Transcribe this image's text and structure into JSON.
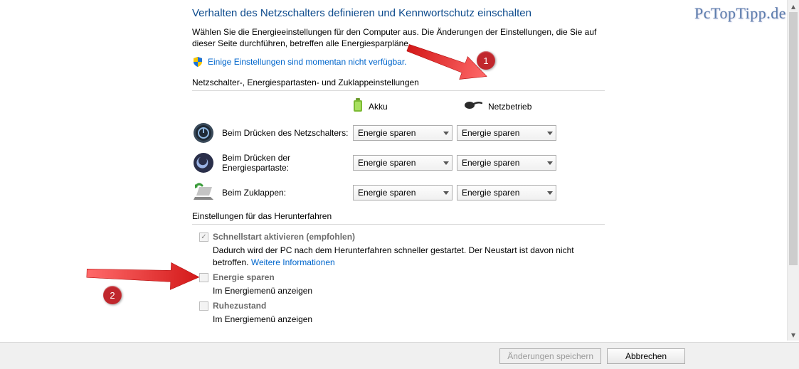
{
  "watermark": "PcTopTipp.de",
  "title": "Verhalten des Netzschalters definieren und Kennwortschutz einschalten",
  "description": "Wählen Sie die Energieeinstellungen für den Computer aus. Die Änderungen der Einstellungen, die Sie auf dieser Seite durchführen, betreffen alle Energiesparpläne.",
  "adminLink": "Einige Einstellungen sind momentan nicht verfügbar.",
  "section1": {
    "heading": "Netzschalter-, Energiespartasten- und Zuklappeinstellungen",
    "columns": {
      "battery": "Akku",
      "ac": "Netzbetrieb"
    },
    "rows": [
      {
        "label": "Beim Drücken des Netzschalters:",
        "battery": "Energie sparen",
        "ac": "Energie sparen"
      },
      {
        "label": "Beim Drücken der Energiespartaste:",
        "battery": "Energie sparen",
        "ac": "Energie sparen"
      },
      {
        "label": "Beim Zuklappen:",
        "battery": "Energie sparen",
        "ac": "Energie sparen"
      }
    ]
  },
  "section2": {
    "heading": "Einstellungen für das Herunterfahren",
    "items": [
      {
        "label": "Schnellstart aktivieren (empfohlen)",
        "checked": true,
        "desc_a": "Dadurch wird der PC nach dem Herunterfahren schneller gestartet. Der Neustart ist davon nicht betroffen. ",
        "moreLink": "Weitere Informationen"
      },
      {
        "label": "Energie sparen",
        "checked": false,
        "sub": "Im Energiemenü anzeigen"
      },
      {
        "label": "Ruhezustand",
        "checked": false,
        "sub": "Im Energiemenü anzeigen"
      }
    ]
  },
  "footer": {
    "save": "Änderungen speichern",
    "cancel": "Abbrechen"
  },
  "annotations": {
    "badge1": "1",
    "badge2": "2"
  }
}
